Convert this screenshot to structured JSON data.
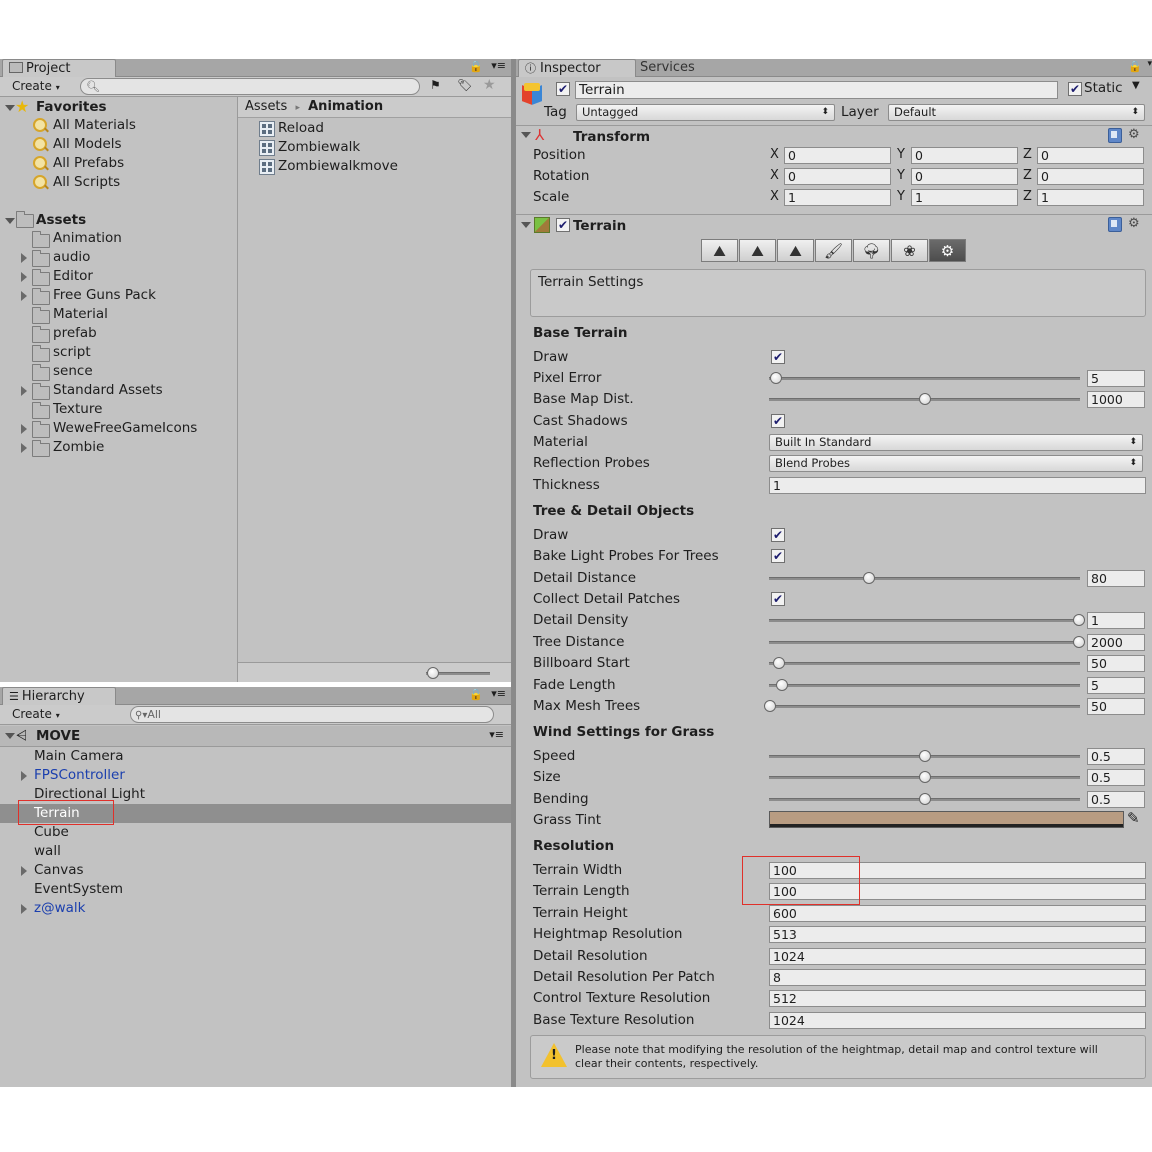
{
  "project": {
    "tab_label": "Project",
    "create_label": "Create",
    "favorites_label": "Favorites",
    "favorites": [
      "All Materials",
      "All Models",
      "All Prefabs",
      "All Scripts"
    ],
    "assets_label": "Assets",
    "assets": [
      {
        "name": "Animation",
        "expandable": false
      },
      {
        "name": "audio",
        "expandable": true
      },
      {
        "name": "Editor",
        "expandable": true
      },
      {
        "name": "Free Guns Pack",
        "expandable": true
      },
      {
        "name": "Material",
        "expandable": false
      },
      {
        "name": "prefab",
        "expandable": false
      },
      {
        "name": "script",
        "expandable": false
      },
      {
        "name": "sence",
        "expandable": false
      },
      {
        "name": "Standard Assets",
        "expandable": true
      },
      {
        "name": "Texture",
        "expandable": false
      },
      {
        "name": "WeweFreeGameIcons",
        "expandable": true
      },
      {
        "name": "Zombie",
        "expandable": true
      }
    ],
    "breadcrumb_root": "Assets",
    "breadcrumb_separator": "▸",
    "breadcrumb_current": "Animation",
    "files": [
      "Reload",
      "Zombiewalk",
      "Zombiewalkmove"
    ],
    "thumbnail_zoom": 0.05
  },
  "hierarchy": {
    "tab_label": "Hierarchy",
    "create_label": "Create",
    "search_placeholder": "All",
    "scene_name": "MOVE",
    "items": [
      {
        "name": "Main Camera",
        "expandable": false,
        "prefab": false,
        "selected": false
      },
      {
        "name": "FPSController",
        "expandable": true,
        "prefab": true,
        "selected": false
      },
      {
        "name": "Directional Light",
        "expandable": false,
        "prefab": false,
        "selected": false
      },
      {
        "name": "Terrain",
        "expandable": false,
        "prefab": false,
        "selected": true
      },
      {
        "name": "Cube",
        "expandable": false,
        "prefab": false,
        "selected": false
      },
      {
        "name": "wall",
        "expandable": false,
        "prefab": false,
        "selected": false
      },
      {
        "name": "Canvas",
        "expandable": true,
        "prefab": false,
        "selected": false
      },
      {
        "name": "EventSystem",
        "expandable": false,
        "prefab": false,
        "selected": false
      },
      {
        "name": "z@walk",
        "expandable": true,
        "prefab": true,
        "selected": false
      }
    ]
  },
  "inspector": {
    "tab_label": "Inspector",
    "services_label": "Services",
    "object_name": "Terrain",
    "static_label": "Static",
    "tag_label": "Tag",
    "tag_value": "Untagged",
    "layer_label": "Layer",
    "layer_value": "Default",
    "transform": {
      "title": "Transform",
      "rows": [
        {
          "label": "Position",
          "x": "0",
          "y": "0",
          "z": "0"
        },
        {
          "label": "Rotation",
          "x": "0",
          "y": "0",
          "z": "0"
        },
        {
          "label": "Scale",
          "x": "1",
          "y": "1",
          "z": "1"
        }
      ],
      "axis_x": "X",
      "axis_y": "Y",
      "axis_z": "Z"
    },
    "terrain": {
      "title": "Terrain",
      "settings_box": "Terrain Settings",
      "base_terrain": {
        "header": "Base Terrain",
        "draw_label": "Draw",
        "pixel_error_label": "Pixel Error",
        "pixel_error": "5",
        "pixel_error_slider": 0.02,
        "base_map_dist_label": "Base Map Dist.",
        "base_map_dist": "1000",
        "base_map_dist_slider": 0.5,
        "cast_shadows_label": "Cast Shadows",
        "material_label": "Material",
        "material_value": "Built In Standard",
        "reflection_label": "Reflection Probes",
        "reflection_value": "Blend Probes",
        "thickness_label": "Thickness",
        "thickness": "1"
      },
      "tree_detail": {
        "header": "Tree & Detail Objects",
        "draw_label": "Draw",
        "bake_label": "Bake Light Probes For Trees",
        "detail_distance_label": "Detail Distance",
        "detail_distance": "80",
        "detail_distance_slider": 0.32,
        "collect_label": "Collect Detail Patches",
        "detail_density_label": "Detail Density",
        "detail_density": "1",
        "detail_density_slider": 1.0,
        "tree_distance_label": "Tree Distance",
        "tree_distance": "2000",
        "tree_distance_slider": 1.0,
        "billboard_label": "Billboard Start",
        "billboard": "50",
        "billboard_slider": 0.03,
        "fade_label": "Fade Length",
        "fade": "5",
        "fade_slider": 0.04,
        "max_mesh_label": "Max Mesh Trees",
        "max_mesh": "50",
        "max_mesh_slider": 0.0
      },
      "wind": {
        "header": "Wind Settings for Grass",
        "speed_label": "Speed",
        "speed": "0.5",
        "speed_slider": 0.5,
        "size_label": "Size",
        "size": "0.5",
        "size_slider": 0.5,
        "bending_label": "Bending",
        "bending": "0.5",
        "bending_slider": 0.5,
        "grass_tint_label": "Grass Tint",
        "grass_tint_color": "#b89c82"
      },
      "resolution": {
        "header": "Resolution",
        "rows": [
          {
            "label": "Terrain Width",
            "value": "100"
          },
          {
            "label": "Terrain Length",
            "value": "100"
          },
          {
            "label": "Terrain Height",
            "value": "600"
          },
          {
            "label": "Heightmap Resolution",
            "value": "513"
          },
          {
            "label": "Detail Resolution",
            "value": "1024"
          },
          {
            "label": "Detail Resolution Per Patch",
            "value": "8"
          },
          {
            "label": "Control Texture Resolution",
            "value": "512"
          },
          {
            "label": "Base Texture Resolution",
            "value": "1024"
          }
        ]
      },
      "warning_line1": "Please note that modifying the resolution of the heightmap, detail map and control texture will",
      "warning_line2": "clear their contents, respectively."
    }
  },
  "colors": {
    "panel_bg": "#c2c2c2",
    "selection": "#8f8f8f",
    "prefab_text": "#1b3fae",
    "highlight_box": "#e0302a"
  }
}
